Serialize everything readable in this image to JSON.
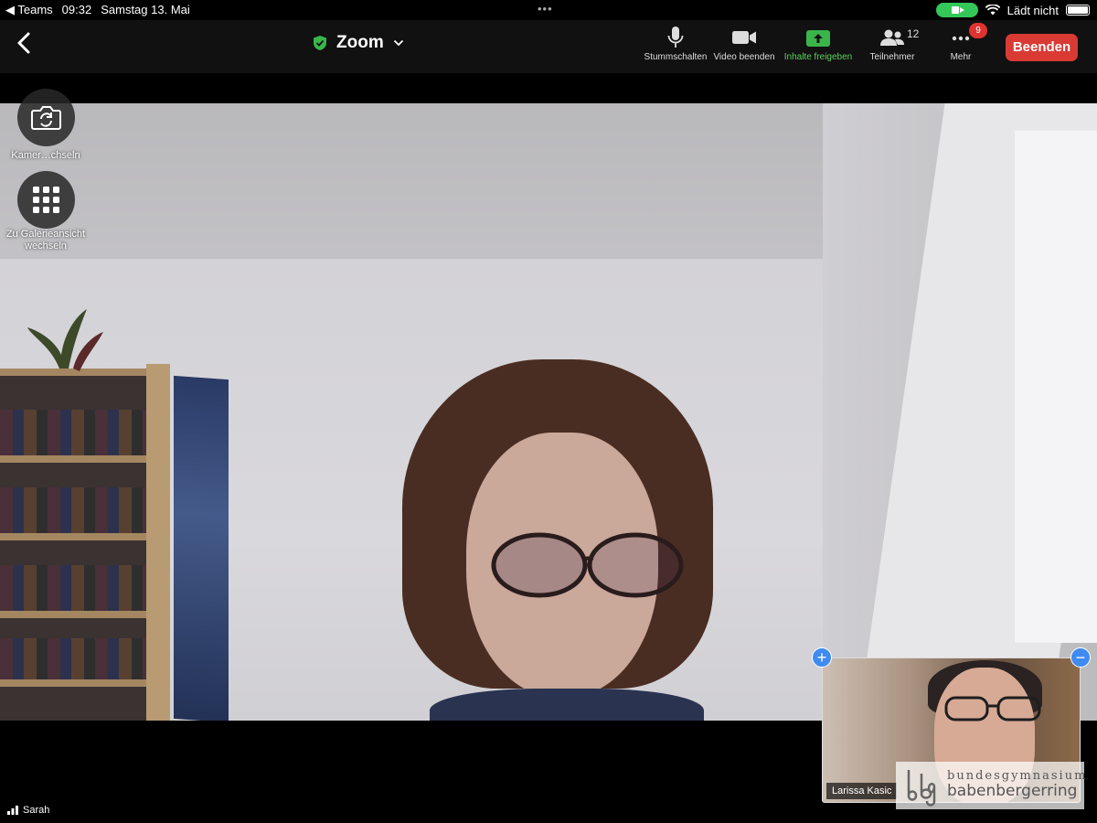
{
  "status_bar": {
    "back_app": "◀ Teams",
    "time": "09:32",
    "date": "Samstag 13. Mai",
    "multitask_dots": "•••",
    "charging": "Lädt nicht"
  },
  "toolbar": {
    "meeting_title": "Zoom",
    "buttons": [
      {
        "label": "Stummschalten",
        "icon": "microphone-icon"
      },
      {
        "label": "Video beenden",
        "icon": "video-camera-icon"
      },
      {
        "label": "Inhalte freigeben",
        "icon": "share-screen-icon"
      },
      {
        "label": "Teilnehmer",
        "icon": "participants-icon",
        "count": "12"
      },
      {
        "label": "Mehr",
        "icon": "more-icon",
        "badge": "9"
      }
    ],
    "end_label": "Beenden",
    "accent_green": "#5ad25a",
    "end_color": "#d93a34"
  },
  "side_controls": {
    "switch_camera": "Kamer…chseln",
    "gallery_view": "Zu Galerieansicht wechseln"
  },
  "self_view": {
    "name": "Larissa Kasic"
  },
  "watermark": {
    "line1": "bundesgymnasium",
    "line2": "babenbergerring"
  },
  "active_speaker": "Sarah"
}
